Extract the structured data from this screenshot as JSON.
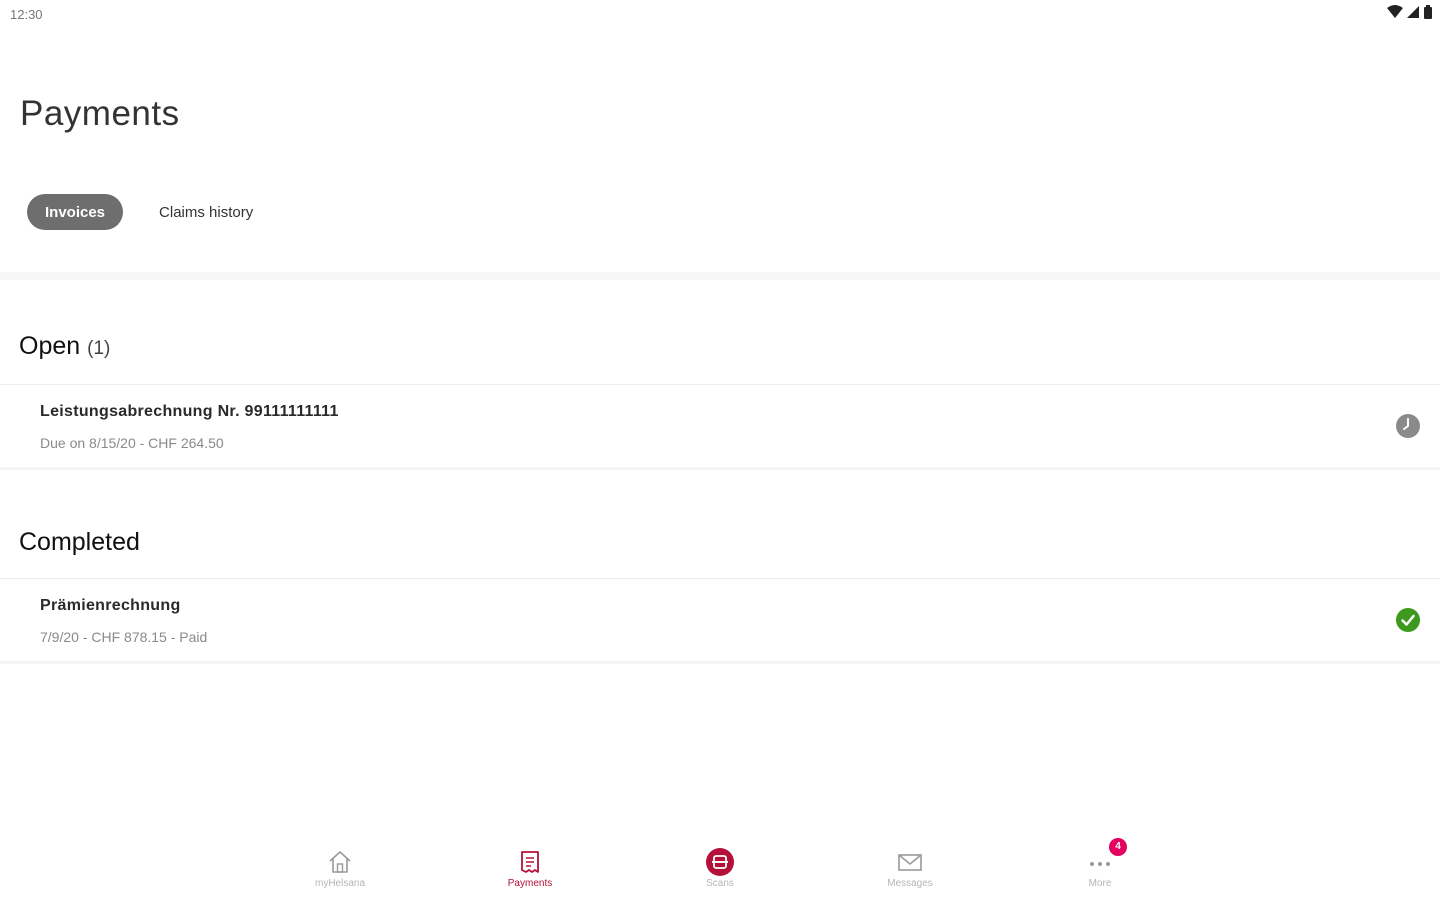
{
  "status_bar": {
    "time": "12:30"
  },
  "page": {
    "title": "Payments"
  },
  "tabs": [
    {
      "label": "Invoices",
      "active": true
    },
    {
      "label": "Claims history",
      "active": false
    }
  ],
  "sections": {
    "open": {
      "title": "Open",
      "count": "(1)",
      "items": [
        {
          "title": "Leistungsabrechnung Nr. 99111111111",
          "subtitle": "Due on 8/15/20 - CHF 264.50",
          "status_icon": "clock-icon"
        }
      ]
    },
    "completed": {
      "title": "Completed",
      "items": [
        {
          "title": "Prämienrechnung",
          "subtitle": "7/9/20 - CHF 878.15 - Paid",
          "status_icon": "check-circle-icon"
        }
      ]
    }
  },
  "bottom_nav": {
    "items": [
      {
        "label": "myHelsana",
        "icon": "home-icon",
        "active": false
      },
      {
        "label": "Payments",
        "icon": "receipt-icon",
        "active": true
      },
      {
        "label": "Scans",
        "icon": "scan-icon",
        "active": false
      },
      {
        "label": "Messages",
        "icon": "envelope-icon",
        "active": false
      },
      {
        "label": "More",
        "icon": "more-dots-icon",
        "active": false,
        "badge": "4"
      }
    ]
  },
  "colors": {
    "accent": "#b5103a",
    "active_tab": "#6e6e6e",
    "success": "#3d9a1e",
    "pending": "#8a8a8a",
    "badge": "#e3005f"
  }
}
